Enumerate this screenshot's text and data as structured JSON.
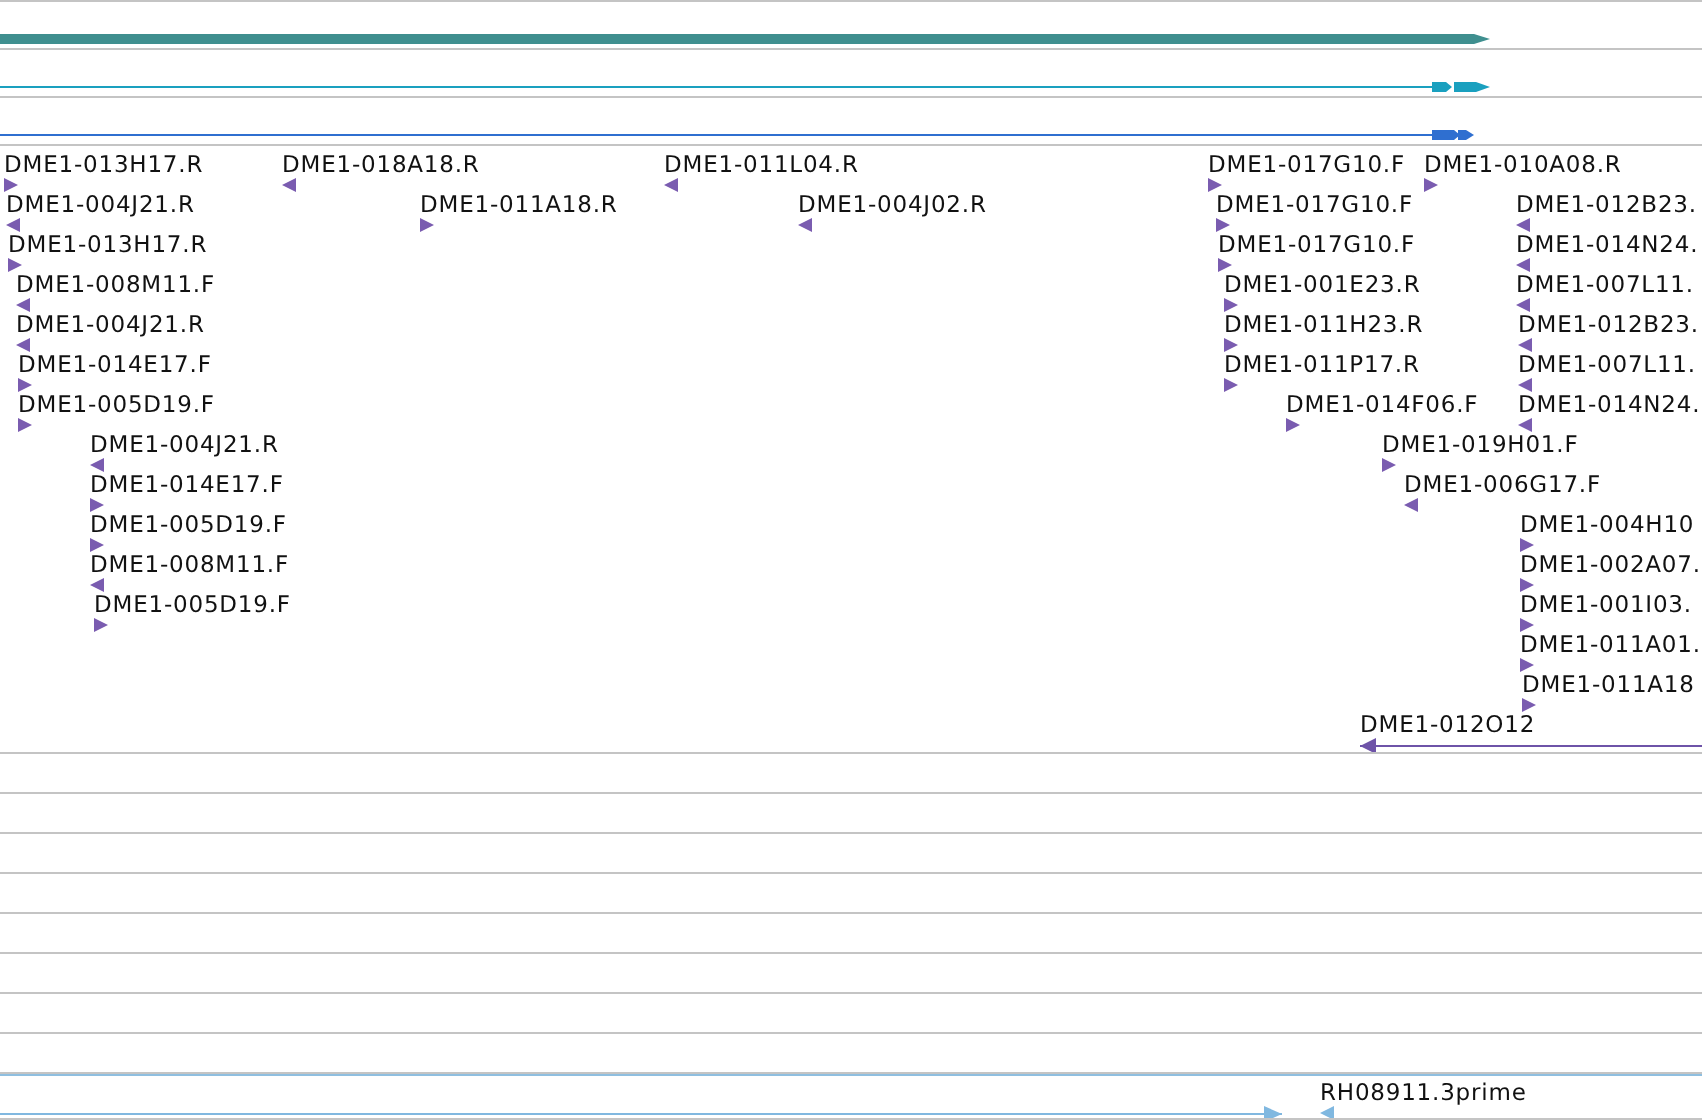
{
  "tracks": [
    {
      "kind": "gene",
      "reverse": false
    },
    {
      "kind": "transcript",
      "reverse": false,
      "color": "#1aa0bf"
    },
    {
      "kind": "transcript",
      "reverse": false,
      "color": "#2f6fd0"
    },
    {
      "kind": "features",
      "features": [
        {
          "label": "DME1-013H17.R",
          "reverse": false
        },
        {
          "label": "DME1-018A18.R",
          "reverse": true
        },
        {
          "label": "DME1-011L04.R",
          "reverse": true
        },
        {
          "label": "DME1-017G10.F",
          "reverse": false
        },
        {
          "label": "DME1-010A08.R",
          "reverse": false
        },
        {
          "label": "DME1-004J21.R",
          "reverse": true
        },
        {
          "label": "DME1-011A18.R",
          "reverse": false
        },
        {
          "label": "DME1-004J02.R",
          "reverse": true
        },
        {
          "label": "DME1-017G10.F",
          "reverse": false
        },
        {
          "label": "DME1-012B23.",
          "reverse": true
        },
        {
          "label": "DME1-013H17.R",
          "reverse": false
        },
        {
          "label": "DME1-017G10.F",
          "reverse": false
        },
        {
          "label": "DME1-014N24.",
          "reverse": true
        },
        {
          "label": "DME1-008M11.F",
          "reverse": true
        },
        {
          "label": "DME1-001E23.R",
          "reverse": false
        },
        {
          "label": "DME1-007L11.",
          "reverse": true
        },
        {
          "label": "DME1-004J21.R",
          "reverse": true
        },
        {
          "label": "DME1-011H23.R",
          "reverse": false
        },
        {
          "label": "DME1-012B23.",
          "reverse": true
        },
        {
          "label": "DME1-014E17.F",
          "reverse": false
        },
        {
          "label": "DME1-011P17.R",
          "reverse": false
        },
        {
          "label": "DME1-007L11.",
          "reverse": true
        },
        {
          "label": "DME1-005D19.F",
          "reverse": false
        },
        {
          "label": "DME1-014F06.F",
          "reverse": false
        },
        {
          "label": "DME1-014N24.",
          "reverse": true
        },
        {
          "label": "DME1-004J21.R",
          "reverse": true
        },
        {
          "label": "DME1-019H01.F",
          "reverse": false
        },
        {
          "label": "DME1-014E17.F",
          "reverse": false
        },
        {
          "label": "DME1-006G17.F",
          "reverse": true
        },
        {
          "label": "DME1-005D19.F",
          "reverse": false
        },
        {
          "label": "DME1-004H10",
          "reverse": false
        },
        {
          "label": "DME1-008M11.F",
          "reverse": true
        },
        {
          "label": "DME1-002A07.",
          "reverse": false
        },
        {
          "label": "DME1-005D19.F",
          "reverse": false
        },
        {
          "label": "DME1-001I03.",
          "reverse": false
        },
        {
          "label": "DME1-011A01.",
          "reverse": false
        },
        {
          "label": "DME1-011A18",
          "reverse": false
        },
        {
          "label": "DME1-012O12",
          "reverse": true
        }
      ]
    },
    {
      "kind": "empty"
    },
    {
      "kind": "empty"
    },
    {
      "kind": "empty"
    },
    {
      "kind": "empty"
    },
    {
      "kind": "empty"
    },
    {
      "kind": "empty"
    },
    {
      "kind": "empty"
    },
    {
      "kind": "empty"
    },
    {
      "kind": "est",
      "features": [
        {
          "reverse": false
        },
        {
          "label": "RH08911.3prime",
          "reverse": true
        }
      ]
    }
  ]
}
